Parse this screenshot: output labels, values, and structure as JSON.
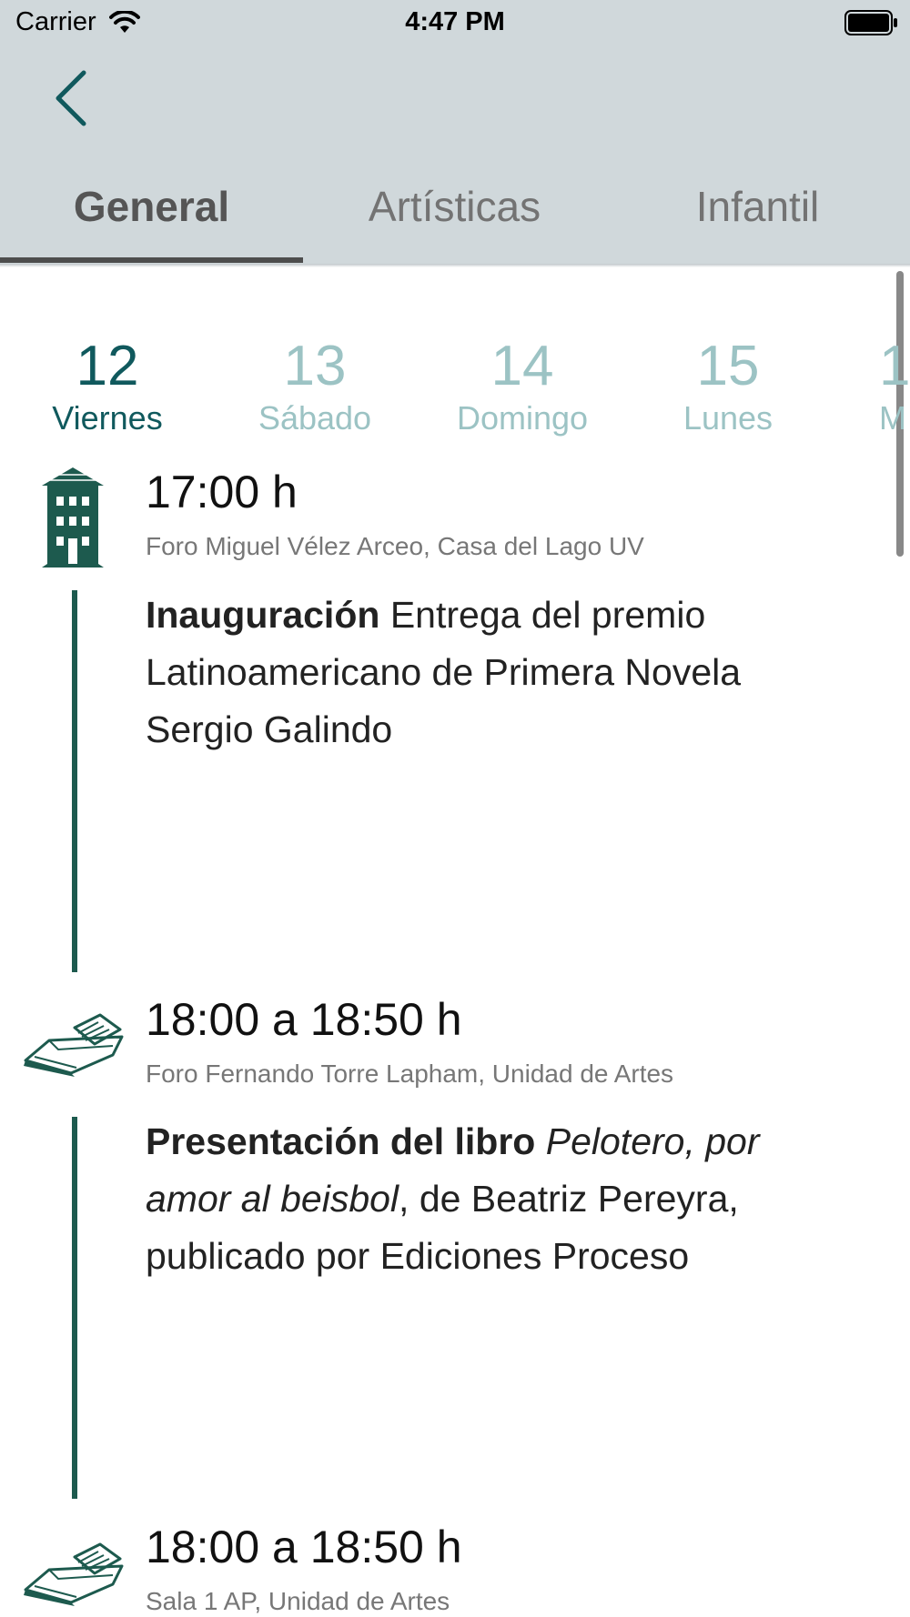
{
  "status_bar": {
    "carrier": "Carrier",
    "time": "4:47 PM"
  },
  "tabs": [
    {
      "label": "General",
      "active": true
    },
    {
      "label": "Artísticas",
      "active": false
    },
    {
      "label": "Infantil",
      "active": false
    }
  ],
  "days": [
    {
      "num": "12",
      "name": "Viernes",
      "active": true
    },
    {
      "num": "13",
      "name": "Sábado",
      "active": false
    },
    {
      "num": "14",
      "name": "Domingo",
      "active": false
    },
    {
      "num": "15",
      "name": "Lunes",
      "active": false
    },
    {
      "num": "1",
      "name": "M",
      "active": false
    }
  ],
  "events": [
    {
      "icon": "building-icon",
      "time": "17:00 h",
      "venue": "Foro Miguel Vélez Arceo, Casa del Lago UV",
      "title_bold": "Inauguración",
      "description": "Entrega del premio Latinoamericano de Primera Novela Sergio Galindo"
    },
    {
      "icon": "book-boat-icon",
      "time": "18:00 a 18:50 h",
      "venue": "Foro Fernando Torre Lapham, Unidad de Artes",
      "title_bold": "Presentación del libro",
      "title_italic": "Pelotero, por amor al beisbol",
      "description": ", de Beatriz Pereyra, publicado por Ediciones Proceso"
    },
    {
      "icon": "book-boat-icon",
      "time": "18:00 a 18:50 h",
      "venue": "Sala 1 AP, Unidad de Artes"
    }
  ],
  "colors": {
    "header_bg": "#d0d8db",
    "accent": "#10595d",
    "timeline": "#1d5a4e",
    "day_inactive": "#9cc3c4"
  }
}
